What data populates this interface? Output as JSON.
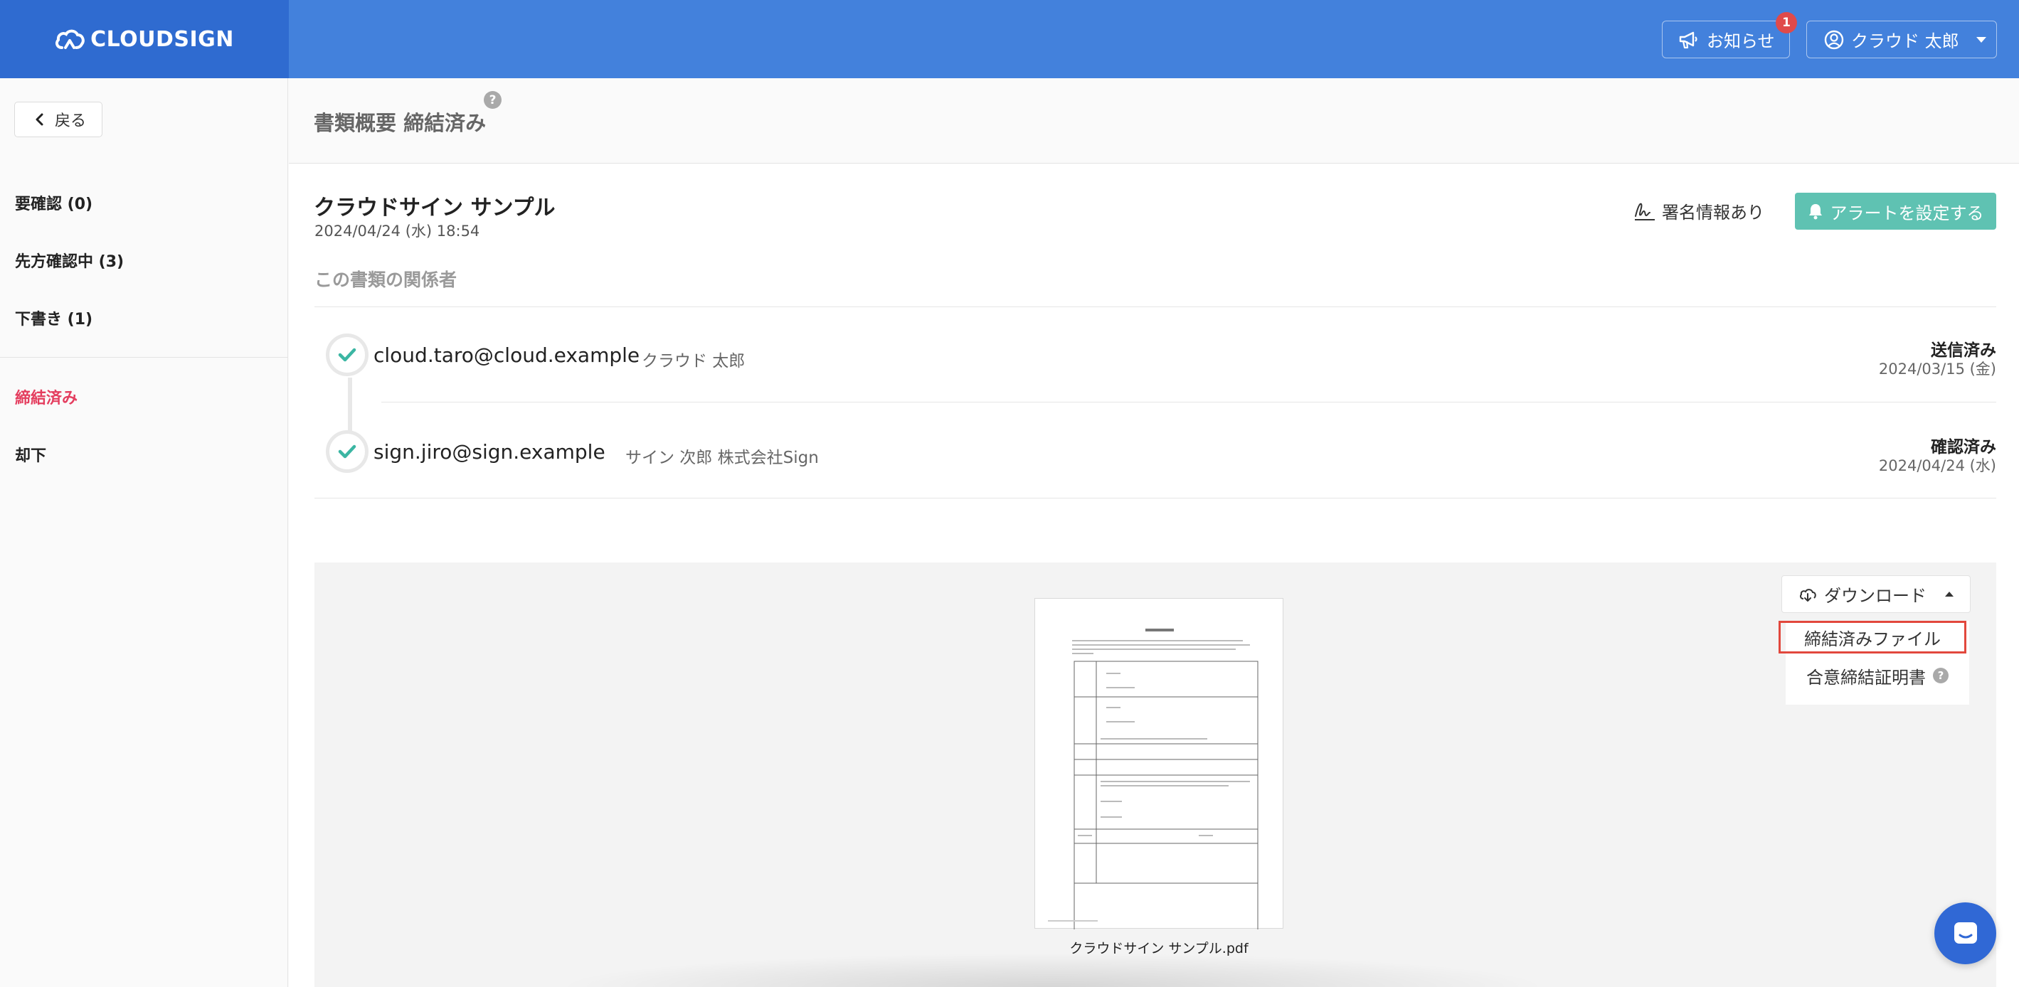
{
  "app": {
    "logo_text": "CLOUDSIGN"
  },
  "header": {
    "notice_label": "お知らせ",
    "notice_badge": "1",
    "user_name": "クラウド 太郎"
  },
  "sidebar": {
    "back_label": "戻る",
    "items": [
      {
        "label": "要確認 (0)"
      },
      {
        "label": "先方確認中 (3)"
      },
      {
        "label": "下書き (1)"
      },
      {
        "label": "締結済み",
        "active": true
      },
      {
        "label": "却下"
      }
    ]
  },
  "title_bar": {
    "title": "書類概要 締結済み",
    "help": "?"
  },
  "document": {
    "title": "クラウドサイン サンプル",
    "date": "2024/04/24 (水) 18:54",
    "sign_info_label": "署名情報あり",
    "alert_button_label": "アラートを設定する",
    "parties_heading": "この書類の関係者",
    "parties": [
      {
        "email": "cloud.taro@cloud.example",
        "name": "クラウド 太郎",
        "status": "送信済み",
        "status_date": "2024/03/15 (金)"
      },
      {
        "email": "sign.jiro@sign.example",
        "name": "サイン 次郎 株式会社Sign",
        "status": "確認済み",
        "status_date": "2024/04/24 (水)"
      }
    ]
  },
  "preview": {
    "file_name": "クラウドサイン サンプル.pdf",
    "download_label": "ダウンロード",
    "menu": [
      {
        "label": "締結済みファイル",
        "selected": true
      },
      {
        "label": "合意締結証明書",
        "help": "?"
      }
    ]
  },
  "colors": {
    "header_bg": "#4381dc",
    "logo_bg": "#2f6bd0",
    "accent_teal": "#5fc2b2",
    "active_red": "#e43d5e",
    "highlight_border": "#e2483d",
    "chat_blue": "#3068d5"
  },
  "icons": [
    "cloud-logo-icon",
    "megaphone-icon",
    "user-circle-icon",
    "chevron-left-icon",
    "signature-icon",
    "bell-icon",
    "check-icon",
    "cloud-download-icon",
    "chat-icon"
  ]
}
